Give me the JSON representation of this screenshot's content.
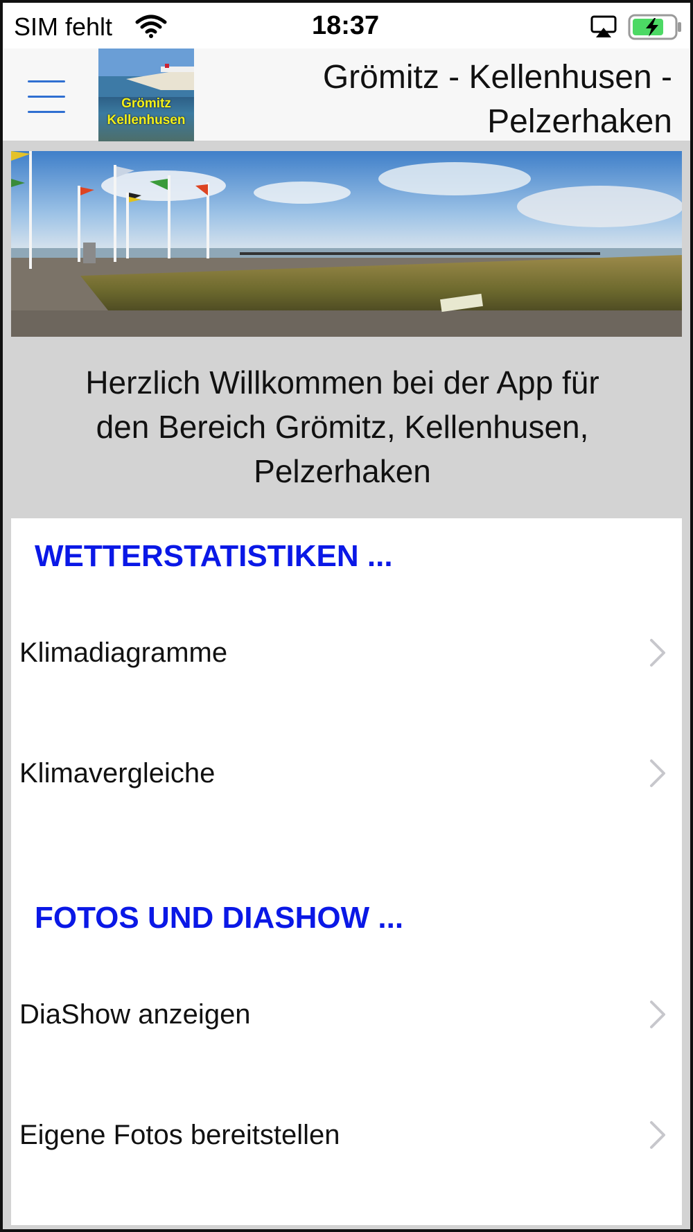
{
  "status_bar": {
    "carrier": "SIM fehlt",
    "time": "18:37",
    "wifi_icon": "wifi-icon",
    "airplay_icon": "airplay-icon",
    "battery_icon": "battery-charging-icon",
    "battery_color": "#4cd964"
  },
  "nav": {
    "menu_icon": "hamburger-menu-icon",
    "logo_line1": "Grömitz",
    "logo_line2": "Kellenhusen",
    "title_line1": "Grömitz - Kellenhusen -",
    "title_line2": "Pelzerhaken",
    "accent": "#2f6fd1"
  },
  "hero": {
    "image_name": "beach-pier-panorama-image"
  },
  "welcome": {
    "line1": "Herzlich Willkommen bei der App für",
    "line2": "den Bereich Grömitz, Kellenhusen,",
    "line3": "Pelzerhaken"
  },
  "sections": [
    {
      "header": "WETTERSTATISTIKEN ...",
      "items": [
        {
          "label": "Klimadiagramme"
        },
        {
          "label": "Klimavergleiche"
        }
      ]
    },
    {
      "header": "FOTOS UND DIASHOW ...",
      "items": [
        {
          "label": "DiaShow anzeigen"
        },
        {
          "label": "Eigene Fotos bereitstellen"
        }
      ]
    }
  ],
  "colors": {
    "section_header": "#0a18e6",
    "background": "#d3d3d3",
    "card": "#ffffff",
    "chevron": "#c7c7cc"
  }
}
